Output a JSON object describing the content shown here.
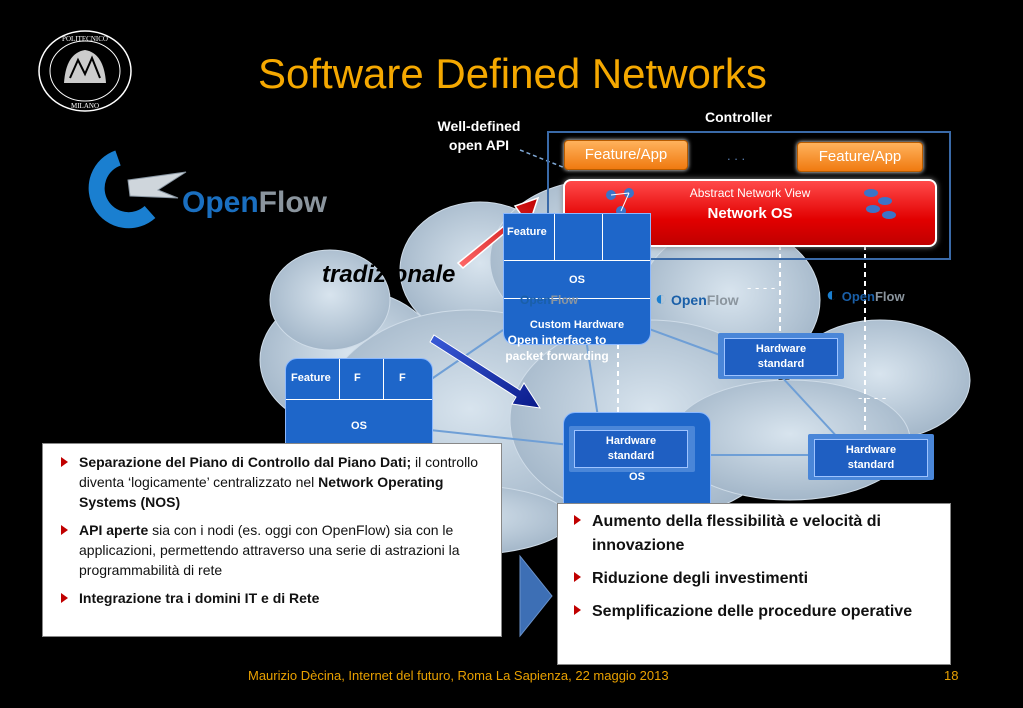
{
  "slide": {
    "title": "Software Defined Networks",
    "footer": "Maurizio Dècina, Internet del futuro, Roma La Sapienza, 22 maggio 2013",
    "page_number": "18",
    "logo_text": {
      "top": "POLITECNICO",
      "bottom": "MILANO"
    }
  },
  "openflow_logo": {
    "word_a": "Open",
    "word_b": "Flow"
  },
  "diagram": {
    "controller_label": "Controller",
    "api_label_line1": "Well-defined",
    "api_label_line2": "open API",
    "feature_app_left": "Feature/App",
    "feature_app_right": "Feature/App",
    "dots": ". . .",
    "abstract_view": "Abstract Network View",
    "network_os": "Network OS",
    "tradizionale": "tradizionale",
    "top_node": {
      "feature": "Feature",
      "os": "OS",
      "custom_hw": "Custom Hardware"
    },
    "open_interface_line1": "Open interface to",
    "open_interface_line2": "packet forwarding",
    "left_node": {
      "feature": "Feature",
      "f1": "F",
      "f2": "F",
      "os": "OS"
    },
    "center_node_os": "OS",
    "hw_top_right": [
      "Hardware",
      "standard"
    ],
    "hw_center": [
      "Hardware",
      "standard"
    ],
    "hw_right": [
      "Hardware",
      "standard"
    ],
    "dashes": "- - - -"
  },
  "left_panel": {
    "bullet1_bold": "Separazione del Piano di Controllo dal Piano Dati;",
    "bullet1_rest": " il controllo diventa ‘logicamente’ centralizzato nel ",
    "bullet1_bold2": "Network Operating Systems (NOS)",
    "bullet2_bold": "API aperte",
    "bullet2_rest": " sia con i nodi (es. oggi con OpenFlow) sia con le applicazioni, permettendo attraverso una serie di astrazioni la programmabilità di rete",
    "bullet3_bold": "Integrazione tra i domini IT e di Rete"
  },
  "right_panel": {
    "items": [
      "Aumento della flessibilità e velocità di innovazione",
      "Riduzione degli investimenti",
      "Semplificazione delle procedure operative"
    ]
  },
  "colors": {
    "title": "#f5a800",
    "accent_red": "#c00000",
    "cloud": "#b7c8d8",
    "node_blue": "#1e66c9"
  }
}
